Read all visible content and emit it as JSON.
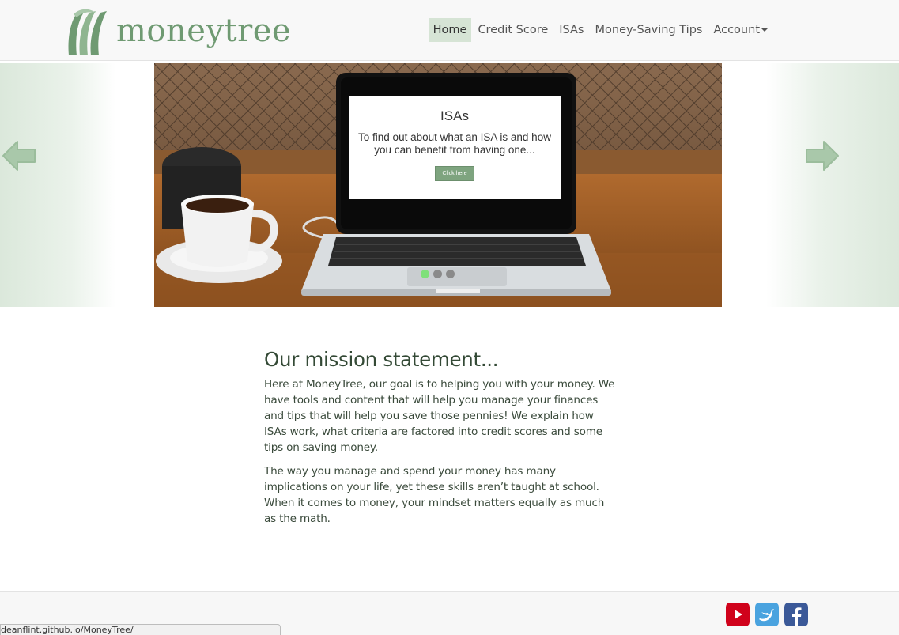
{
  "brand": {
    "name": "moneytree",
    "logo_icon": "moneytree-logo-icon"
  },
  "nav": {
    "items": [
      {
        "label": "Home",
        "active": true
      },
      {
        "label": "Credit Score"
      },
      {
        "label": "ISAs"
      },
      {
        "label": "Money-Saving Tips"
      },
      {
        "label": "Account",
        "dropdown": true
      }
    ]
  },
  "carousel": {
    "prev_icon": "arrow-left-icon",
    "next_icon": "arrow-right-icon",
    "slide": {
      "title": "ISAs",
      "text": "To find out about what an ISA is and how you can benefit from having one...",
      "button_label": "Click here"
    },
    "indicator_count": 3,
    "active_indicator": 0
  },
  "mission": {
    "heading": "Our mission statement...",
    "paragraphs": [
      "Here at MoneyTree, our goal is to helping you with your money. We have tools and content that will help you manage your finances and tips that will help you save those pennies! We explain how ISAs work, what criteria are factored into credit scores and some tips on saving money.",
      "The way you manage and spend your money has many implications on your life, yet these skills aren’t taught at school. When it comes to money, your mindset matters equally as much as the math."
    ]
  },
  "footer": {
    "social": [
      {
        "name": "youtube-icon",
        "color": "#d0021b"
      },
      {
        "name": "twitter-icon",
        "color": "#4aa3df"
      },
      {
        "name": "facebook-icon",
        "color": "#3b5998"
      }
    ]
  },
  "status_bar": {
    "url": "deanflint.github.io/MoneyTree/"
  },
  "colors": {
    "accent": "#6f9a72",
    "nav_active_bg": "#d6e4d5",
    "indicator_active": "#7fe07a"
  }
}
